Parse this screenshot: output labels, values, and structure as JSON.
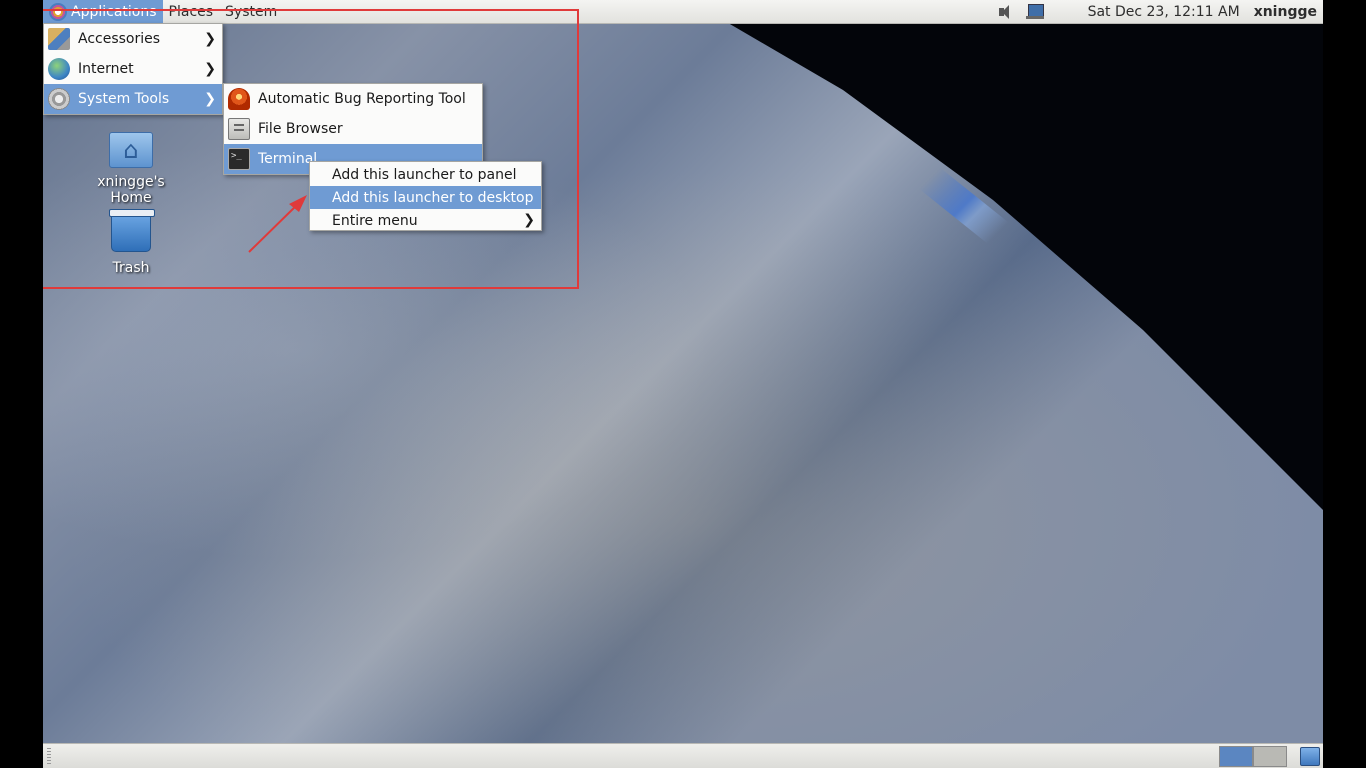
{
  "top_panel": {
    "menus": [
      "Applications",
      "Places",
      "System"
    ],
    "clock": "Sat Dec 23, 12:11 AM",
    "username": "xningge",
    "tray_icons": [
      "speaker-icon",
      "network-icon"
    ]
  },
  "desktop_icons": [
    {
      "label": "xningge's Home",
      "icon": "home-folder-icon"
    },
    {
      "label": "Trash",
      "icon": "trash-icon"
    }
  ],
  "applications_menu": {
    "items": [
      {
        "label": "Accessories",
        "icon": "accessories-icon",
        "submenu": true
      },
      {
        "label": "Internet",
        "icon": "internet-icon",
        "submenu": true
      },
      {
        "label": "System Tools",
        "icon": "system-tools-icon",
        "submenu": true,
        "highlighted": true
      }
    ]
  },
  "system_tools_menu": {
    "items": [
      {
        "label": "Automatic Bug Reporting Tool",
        "icon": "bug-report-icon"
      },
      {
        "label": "File Browser",
        "icon": "file-browser-icon"
      },
      {
        "label": "Terminal",
        "icon": "terminal-icon",
        "highlighted": true
      }
    ]
  },
  "context_menu": {
    "items": [
      {
        "label": "Add this launcher to panel"
      },
      {
        "label": "Add this launcher to desktop",
        "highlighted": true
      },
      {
        "label": "Entire menu",
        "submenu": true
      }
    ]
  },
  "bottom_panel": {
    "workspaces": [
      "workspace-1",
      "workspace-2"
    ],
    "active_workspace": 1
  },
  "colors": {
    "highlight": "#6f9bd3",
    "annotation": "#e03a3a"
  }
}
